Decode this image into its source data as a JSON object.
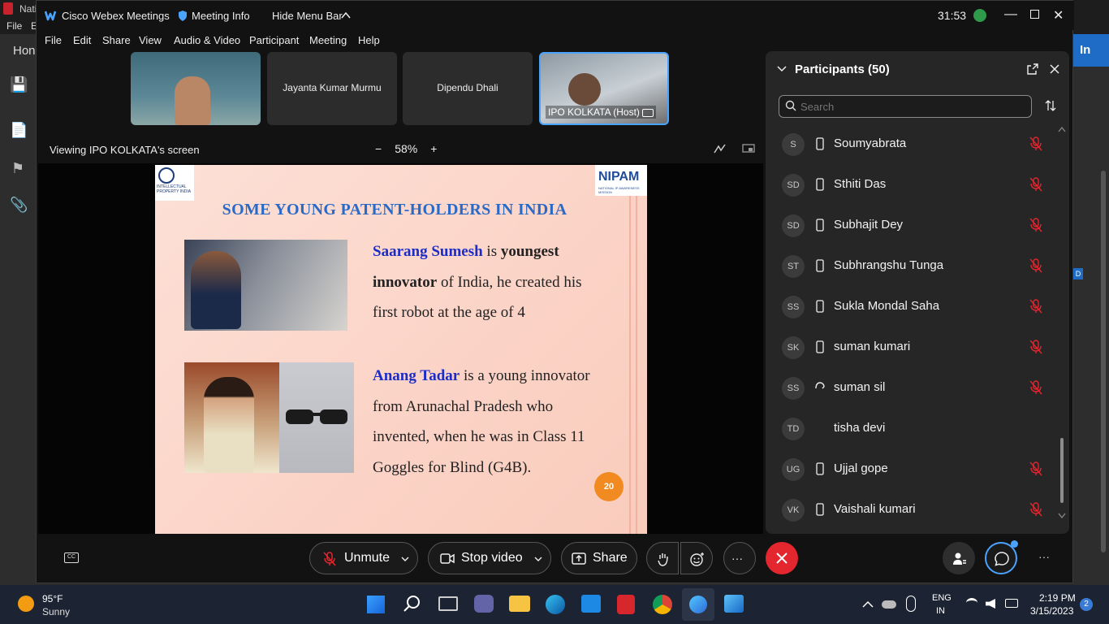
{
  "bg_app": {
    "title_fragment": "Nati",
    "menu_file": "File",
    "menu_e": "E",
    "home_fragment": "Hon",
    "right_fragment": "In",
    "right_badge": "D"
  },
  "window": {
    "app_title": "Cisco Webex Meetings",
    "meeting_info": "Meeting Info",
    "hide_menu_bar": "Hide Menu Bar",
    "timer": "31:53"
  },
  "menu": [
    "File",
    "Edit",
    "Share",
    "View",
    "Audio & Video",
    "Participant",
    "Meeting",
    "Help"
  ],
  "thumbnails": [
    {
      "name": ""
    },
    {
      "name": "Jayanta Kumar Murmu"
    },
    {
      "name": "Dipendu Dhali"
    },
    {
      "name": "IPO KOLKATA (Host)"
    }
  ],
  "viewing": {
    "label": "Viewing IPO KOLKATA's screen",
    "zoom_minus": "−",
    "zoom": "58%",
    "zoom_plus": "+"
  },
  "slide": {
    "logo_left_text": "INTELLECTUAL PROPERTY INDIA",
    "logo_right_text": "NIPAM",
    "logo_right_sub": "NATIONAL IP AWARENESS MISSION",
    "title": "SOME YOUNG PATENT-HOLDERS IN INDIA",
    "p1_name": "Saarang Sumesh",
    "p1_is": " is ",
    "p1_youngest": "youngest",
    "p1_innovator": "innovator",
    "p1_rest": " of India, he created his",
    "p1_line3": "first robot at the age of 4",
    "p2_name": "Anang Tadar",
    "p2_rest": " is a young innovator",
    "p2_line2": "from Arunachal Pradesh who",
    "p2_line3": "invented, when he was in Class 11",
    "p2_line4": "Goggles for Blind (G4B).",
    "page_number": "20"
  },
  "participants": {
    "header": "Participants (50)",
    "search_placeholder": "Search",
    "list": [
      {
        "initials": "S",
        "name": "Soumyabrata",
        "device": "phone",
        "muted": true
      },
      {
        "initials": "SD",
        "name": "Sthiti Das",
        "device": "phone",
        "muted": true
      },
      {
        "initials": "SD",
        "name": "Subhajit Dey",
        "device": "phone",
        "muted": true
      },
      {
        "initials": "ST",
        "name": "Subhrangshu Tunga",
        "device": "phone",
        "muted": true
      },
      {
        "initials": "SS",
        "name": "Sukla Mondal Saha",
        "device": "phone",
        "muted": true
      },
      {
        "initials": "SK",
        "name": "suman kumari",
        "device": "phone",
        "muted": true
      },
      {
        "initials": "SS",
        "name": "suman sil",
        "device": "headset",
        "muted": true
      },
      {
        "initials": "TD",
        "name": "tisha devi",
        "device": "none",
        "muted": false
      },
      {
        "initials": "UG",
        "name": "Ujjal gope",
        "device": "phone",
        "muted": true
      },
      {
        "initials": "VK",
        "name": "Vaishali kumari",
        "device": "phone",
        "muted": true
      }
    ]
  },
  "controls": {
    "unmute": "Unmute",
    "stop_video": "Stop video",
    "share": "Share",
    "more": "···"
  },
  "taskbar": {
    "weather_temp": "95°F",
    "weather_desc": "Sunny",
    "lang_top": "ENG",
    "lang_bottom": "IN",
    "time": "2:19 PM",
    "date": "3/15/2023",
    "notif_count": "2"
  },
  "colors": {
    "accent": "#4aa3ff",
    "leave": "#e4262f",
    "slide_title": "#2b69c6",
    "name_blue": "#1c2cc7",
    "badge": "#f28a22"
  }
}
